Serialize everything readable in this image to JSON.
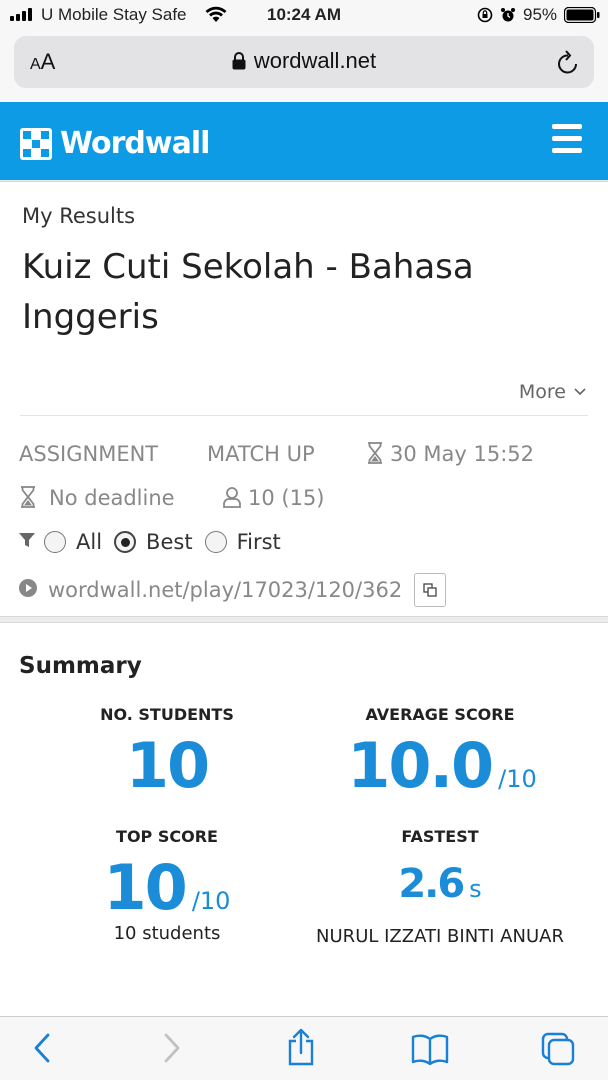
{
  "status_bar": {
    "carrier": "U Mobile Stay Safe",
    "time": "10:24 AM",
    "battery": "95%"
  },
  "browser": {
    "text_size_large": "A",
    "text_size_small": "A",
    "url": "wordwall.net"
  },
  "header": {
    "logo": "Wordwall"
  },
  "results": {
    "breadcrumb": "My Results",
    "title": "Kuiz Cuti Sekolah - Bahasa Inggeris",
    "more_label": "More",
    "assignment_label": "ASSIGNMENT",
    "activity_type": "MATCH UP",
    "date": "30 May 15:52",
    "deadline": "No deadline",
    "students": "10 (15)",
    "filters": [
      "All",
      "Best",
      "First"
    ],
    "selected_filter": "Best",
    "link": "wordwall.net/play/17023/120/362"
  },
  "summary": {
    "title": "Summary",
    "students_label": "NO. STUDENTS",
    "students_value": "10",
    "average_label": "AVERAGE SCORE",
    "average_value": "10.0",
    "average_denom": "/10",
    "top_label": "TOP SCORE",
    "top_value": "10",
    "top_denom": "/10",
    "top_sub": "10 students",
    "fastest_label": "FASTEST",
    "fastest_value": "2.6",
    "fastest_unit": "s",
    "fastest_name": "NURUL IZZATI BINTI ANUAR"
  },
  "colors": {
    "brand": "#0e9be6",
    "stat_blue": "#1a8cd8",
    "ios_blue": "#1a7fd6"
  }
}
